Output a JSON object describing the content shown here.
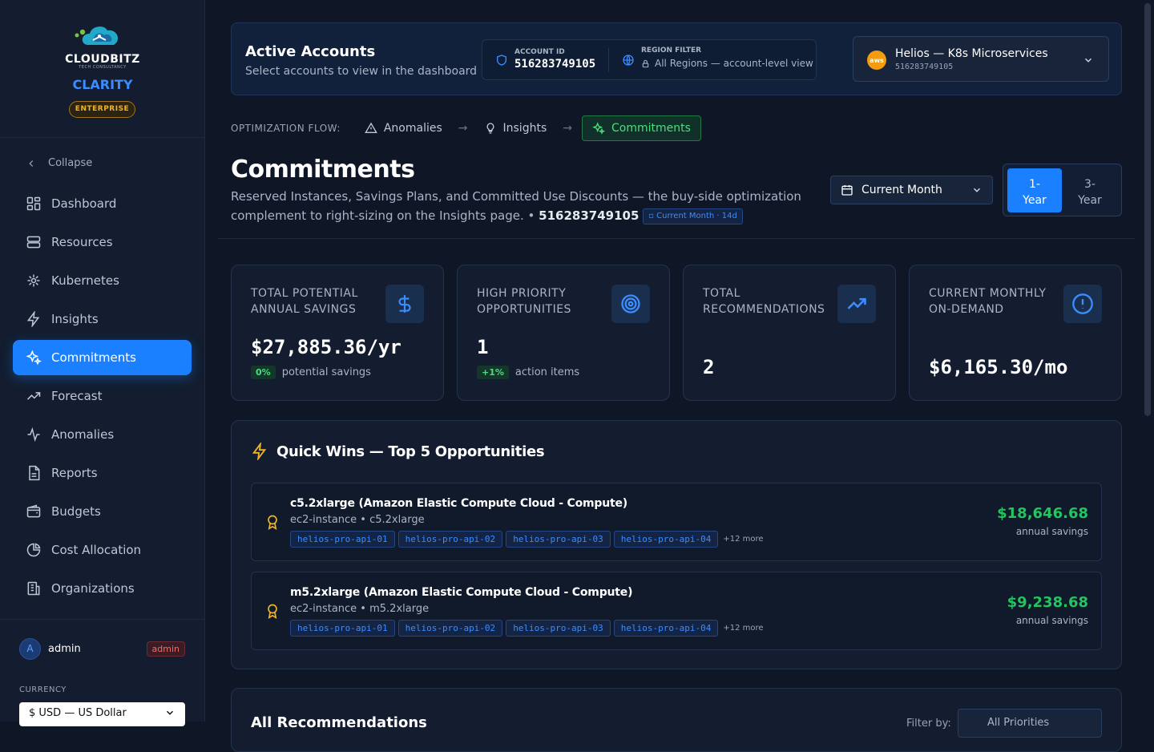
{
  "brand": {
    "name": "CLOUDBITZ",
    "tagline": "TECH CONSULTANCY",
    "product": "CLARITY",
    "tier": "ENTERPRISE"
  },
  "sidebar": {
    "collapse_label": "Collapse",
    "items": [
      {
        "label": "Dashboard",
        "icon": "dashboard-icon"
      },
      {
        "label": "Resources",
        "icon": "server-icon"
      },
      {
        "label": "Kubernetes",
        "icon": "kubernetes-icon"
      },
      {
        "label": "Insights",
        "icon": "lightning-icon"
      },
      {
        "label": "Commitments",
        "icon": "sparkles-icon",
        "active": true
      },
      {
        "label": "Forecast",
        "icon": "trend-icon"
      },
      {
        "label": "Anomalies",
        "icon": "pulse-icon"
      },
      {
        "label": "Reports",
        "icon": "document-icon"
      },
      {
        "label": "Budgets",
        "icon": "wallet-icon"
      },
      {
        "label": "Cost Allocation",
        "icon": "pie-icon"
      },
      {
        "label": "Organizations",
        "icon": "building-icon"
      }
    ],
    "user": {
      "initial": "A",
      "name": "admin",
      "role": "admin"
    },
    "currency_label": "CURRENCY",
    "currency_value": "$ USD — US Dollar"
  },
  "accounts": {
    "title": "Active Accounts",
    "subtitle": "Select accounts to view in the dashboard",
    "account_id_label": "ACCOUNT ID",
    "account_id": "516283749105",
    "region_label": "REGION FILTER",
    "region_value": "All Regions — account-level view",
    "selected_name": "Helios — K8s Microservices",
    "selected_id": "516283749105",
    "provider_badge": "aws"
  },
  "flow": {
    "label": "OPTIMIZATION FLOW:",
    "steps": [
      "Anomalies",
      "Insights",
      "Commitments"
    ]
  },
  "page": {
    "title": "Commitments",
    "description": "Reserved Instances, Savings Plans, and Committed Use Discounts — the buy-side optimization complement to right-sizing on the Insights page.",
    "account": "516283749105",
    "period_tag": "Current Month · 14d",
    "period_select": "Current Month",
    "terms": [
      "1-\nYear",
      "3-\nYear"
    ]
  },
  "stats": [
    {
      "label": "TOTAL POTENTIAL ANNUAL SAVINGS",
      "value": "$27,885.36/yr",
      "pct": "0%",
      "note": "potential savings",
      "icon": "dollar-icon"
    },
    {
      "label": "HIGH PRIORITY OPPORTUNITIES",
      "value": "1",
      "pct": "+1%",
      "note": "action items",
      "icon": "target-icon"
    },
    {
      "label": "TOTAL RECOMMENDATIONS",
      "value": "2",
      "icon": "trend-up-icon"
    },
    {
      "label": "CURRENT MONTHLY ON-DEMAND",
      "value": "$6,165.30/mo",
      "icon": "alert-circle-icon"
    }
  ],
  "quick_wins": {
    "title": "Quick Wins — Top 5 Opportunities",
    "items": [
      {
        "name": "c5.2xlarge (Amazon Elastic Compute Cloud - Compute)",
        "type": "ec2-instance • c5.2xlarge",
        "tags": [
          "helios-pro-api-01",
          "helios-pro-api-02",
          "helios-pro-api-03",
          "helios-pro-api-04"
        ],
        "more": "+12 more",
        "amount": "$18,646.68",
        "amount_label": "annual savings"
      },
      {
        "name": "m5.2xlarge (Amazon Elastic Compute Cloud - Compute)",
        "type": "ec2-instance • m5.2xlarge",
        "tags": [
          "helios-pro-api-01",
          "helios-pro-api-02",
          "helios-pro-api-03",
          "helios-pro-api-04"
        ],
        "more": "+12 more",
        "amount": "$9,238.68",
        "amount_label": "annual savings"
      }
    ]
  },
  "all_recs": {
    "title": "All Recommendations",
    "filter_label": "Filter by:",
    "filter_value": "All Priorities"
  },
  "colors": {
    "accent": "#1a80ff",
    "success": "#22c55e",
    "warning": "#f0b429",
    "background": "#0f1727"
  }
}
